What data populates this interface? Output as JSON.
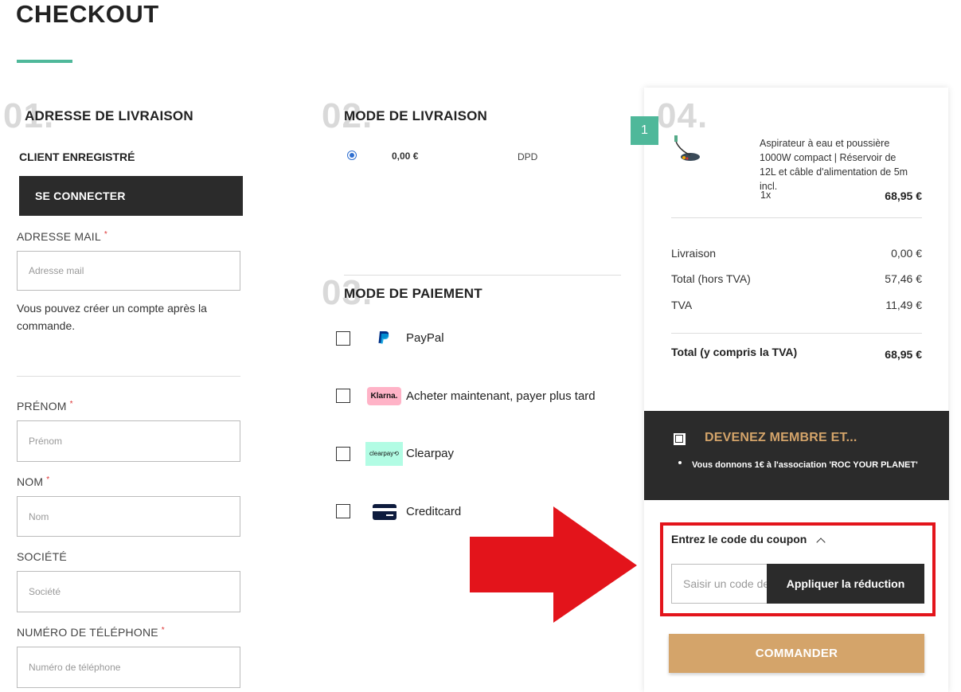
{
  "page": {
    "title": "CHECKOUT"
  },
  "shipping_address": {
    "step_number": "01.",
    "title": "ADRESSE DE LIVRAISON",
    "registered_client_label": "CLIENT ENREGISTRÉ",
    "login_button": "SE CONNECTER",
    "email_label": "ADRESSE MAIL",
    "email_placeholder": "Adresse mail",
    "account_note": "Vous pouvez créer un compte après la commande.",
    "firstname_label": "PRÉNOM",
    "firstname_placeholder": "Prénom",
    "lastname_label": "NOM",
    "lastname_placeholder": "Nom",
    "company_label": "SOCIÉTÉ",
    "company_placeholder": "Société",
    "phone_label": "NUMÉRO DE TÉLÉPHONE",
    "phone_placeholder": "Numéro de téléphone",
    "required_mark": "*"
  },
  "shipping_method": {
    "step_number": "02.",
    "title": "MODE DE LIVRAISON",
    "option_price": "0,00 €",
    "option_carrier": "DPD"
  },
  "payment_method": {
    "step_number": "03.",
    "title": "MODE DE PAIEMENT",
    "options": [
      {
        "label": "PayPal",
        "icon": "paypal-icon"
      },
      {
        "label": "Acheter maintenant, payer plus tard",
        "icon": "klarna-logo",
        "logo_text": "Klarna."
      },
      {
        "label": "Clearpay",
        "icon": "clearpay-logo",
        "logo_text": "clearpay"
      },
      {
        "label": "Creditcard",
        "icon": "credit-card-icon"
      }
    ]
  },
  "summary": {
    "step_number": "04.",
    "qty_badge": "1",
    "product": {
      "name": "Aspirateur à eau et poussière 1000W compact | Réservoir de 12L et câble d'alimentation de 5m incl.",
      "qty": "1x",
      "price": "68,95 €",
      "icon": "vacuum-cleaner-image"
    },
    "rows": [
      {
        "label": "Livraison",
        "value": "0,00 €"
      },
      {
        "label": "Total (hors TVA)",
        "value": "57,46 €"
      },
      {
        "label": "TVA",
        "value": "11,49 €"
      }
    ],
    "total_label": "Total (y compris la TVA)",
    "total_value": "68,95 €"
  },
  "membership": {
    "title": "DEVENEZ MEMBRE ET...",
    "benefit": "Vous donnons 1€ à l'association 'ROC YOUR PLANET'"
  },
  "coupon": {
    "toggle_label": "Entrez le code du coupon",
    "input_placeholder": "Saisir un code de réduction",
    "apply_button": "Appliquer la réduction"
  },
  "order_button": "COMMANDER",
  "colors": {
    "accent_green": "#4fb89a",
    "dark": "#2b2b2b",
    "gold": "#d4a46a",
    "highlight_red": "#e3141b"
  }
}
